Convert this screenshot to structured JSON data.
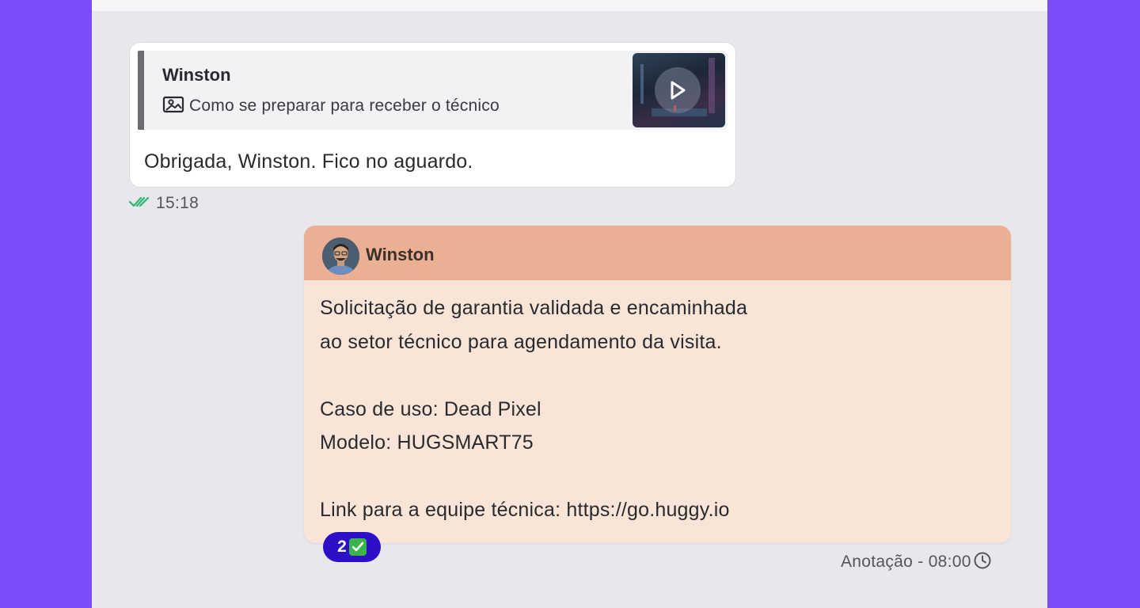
{
  "quoted_message": {
    "author": "Winston",
    "text": "Como se preparar para receber o técnico",
    "attachment_icon": "image-icon",
    "thumbnail_icon": "play-icon"
  },
  "incoming_message": {
    "text": "Obrigada, Winston. Fico no aguardo.",
    "time": "15:18",
    "status_icon": "double-check-icon",
    "status_color": "#2bb673"
  },
  "note": {
    "author": "Winston",
    "header_color": "#ebb093",
    "background_color": "#f8e5d8",
    "lines": [
      "Solicitação de garantia validada e encaminhada",
      "ao setor técnico para agendamento da visita.",
      "",
      "Caso de uso: Dead Pixel",
      "Modelo: HUGSMART75",
      "",
      "Link para a equipe técnica: https://go.huggy.io"
    ],
    "reaction": {
      "count": "2",
      "emoji": "check-mark-button-icon",
      "color": "#2b10c8"
    },
    "meta": "Anotação - 08:00",
    "meta_icon": "clock-icon"
  }
}
